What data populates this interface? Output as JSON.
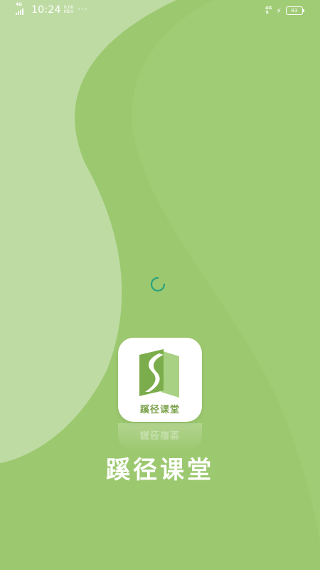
{
  "status_bar": {
    "signal_label": "4G",
    "time": "10:24",
    "speed_value": "0.00",
    "speed_unit": "KB/s",
    "more": "···",
    "network_label": "4G",
    "battery_level": "83"
  },
  "splash": {
    "logo_text": "蹊径课堂",
    "app_name": "蹊径课堂"
  },
  "colors": {
    "background": "#9cc86f",
    "light_wave": "#bedba3",
    "spinner": "#2aa37e",
    "logo_dark": "#7cad4c",
    "logo_light": "#a8d183"
  },
  "icons": {
    "spinner": "loading-spinner-icon",
    "logo": "path-book-logo-icon",
    "charging": "bolt-icon"
  }
}
